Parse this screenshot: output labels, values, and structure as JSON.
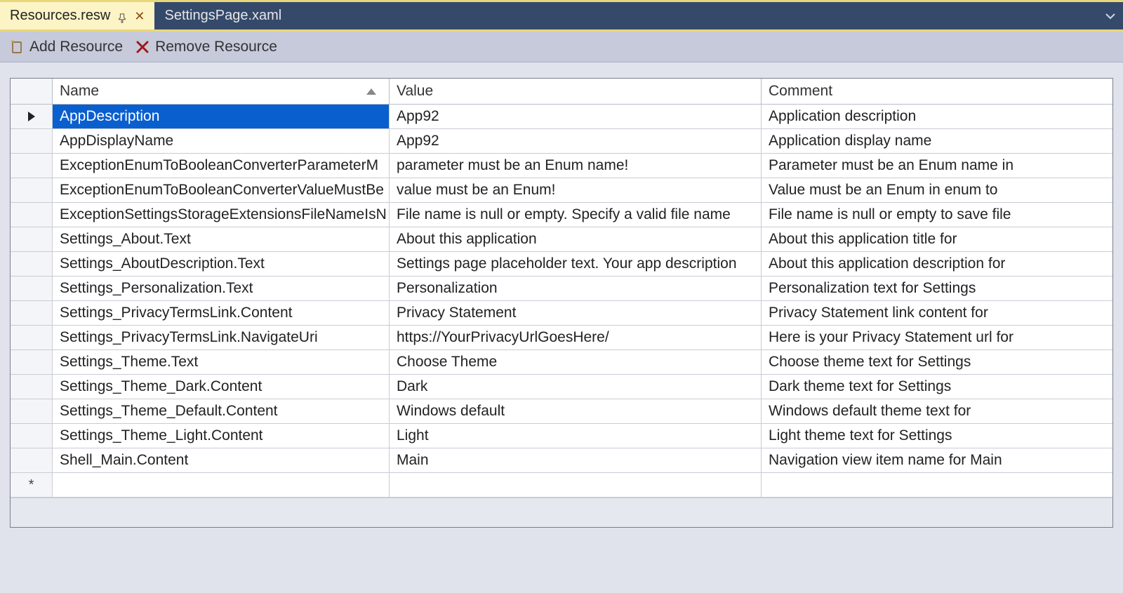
{
  "tabs": [
    {
      "label": "Resources.resw",
      "active": true,
      "pinned": true
    },
    {
      "label": "SettingsPage.xaml",
      "active": false,
      "pinned": false
    }
  ],
  "toolbar": {
    "add_label": "Add Resource",
    "remove_label": "Remove Resource"
  },
  "grid": {
    "headers": {
      "name": "Name",
      "value": "Value",
      "comment": "Comment"
    },
    "rows": [
      {
        "name": "AppDescription",
        "value": "App92",
        "comment": "Application description",
        "selected": true
      },
      {
        "name": "AppDisplayName",
        "value": "App92",
        "comment": "Application display name"
      },
      {
        "name": "ExceptionEnumToBooleanConverterParameterM",
        "value": "parameter must be an Enum name!",
        "comment": "Parameter must be an Enum name in"
      },
      {
        "name": "ExceptionEnumToBooleanConverterValueMustBe",
        "value": "value must be an Enum!",
        "comment": "Value must be an Enum in enum to"
      },
      {
        "name": "ExceptionSettingsStorageExtensionsFileNameIsN",
        "value": "File name is null or empty. Specify a valid file name",
        "comment": "File name is null or empty to save file"
      },
      {
        "name": "Settings_About.Text",
        "value": "About this application",
        "comment": "About this application title for"
      },
      {
        "name": "Settings_AboutDescription.Text",
        "value": "Settings page placeholder text.  Your app description",
        "comment": "About this application description for"
      },
      {
        "name": "Settings_Personalization.Text",
        "value": "Personalization",
        "comment": "Personalization text for Settings"
      },
      {
        "name": "Settings_PrivacyTermsLink.Content",
        "value": "Privacy Statement",
        "comment": "Privacy Statement link content for"
      },
      {
        "name": "Settings_PrivacyTermsLink.NavigateUri",
        "value": "https://YourPrivacyUrlGoesHere/",
        "comment": "Here is your Privacy Statement url for"
      },
      {
        "name": "Settings_Theme.Text",
        "value": "Choose Theme",
        "comment": "Choose theme text for Settings"
      },
      {
        "name": "Settings_Theme_Dark.Content",
        "value": "Dark",
        "comment": "Dark theme text for Settings"
      },
      {
        "name": "Settings_Theme_Default.Content",
        "value": "Windows default",
        "comment": "Windows default theme text for"
      },
      {
        "name": "Settings_Theme_Light.Content",
        "value": "Light",
        "comment": "Light theme text for Settings"
      },
      {
        "name": "Shell_Main.Content",
        "value": "Main",
        "comment": "Navigation view item name for Main"
      }
    ]
  }
}
